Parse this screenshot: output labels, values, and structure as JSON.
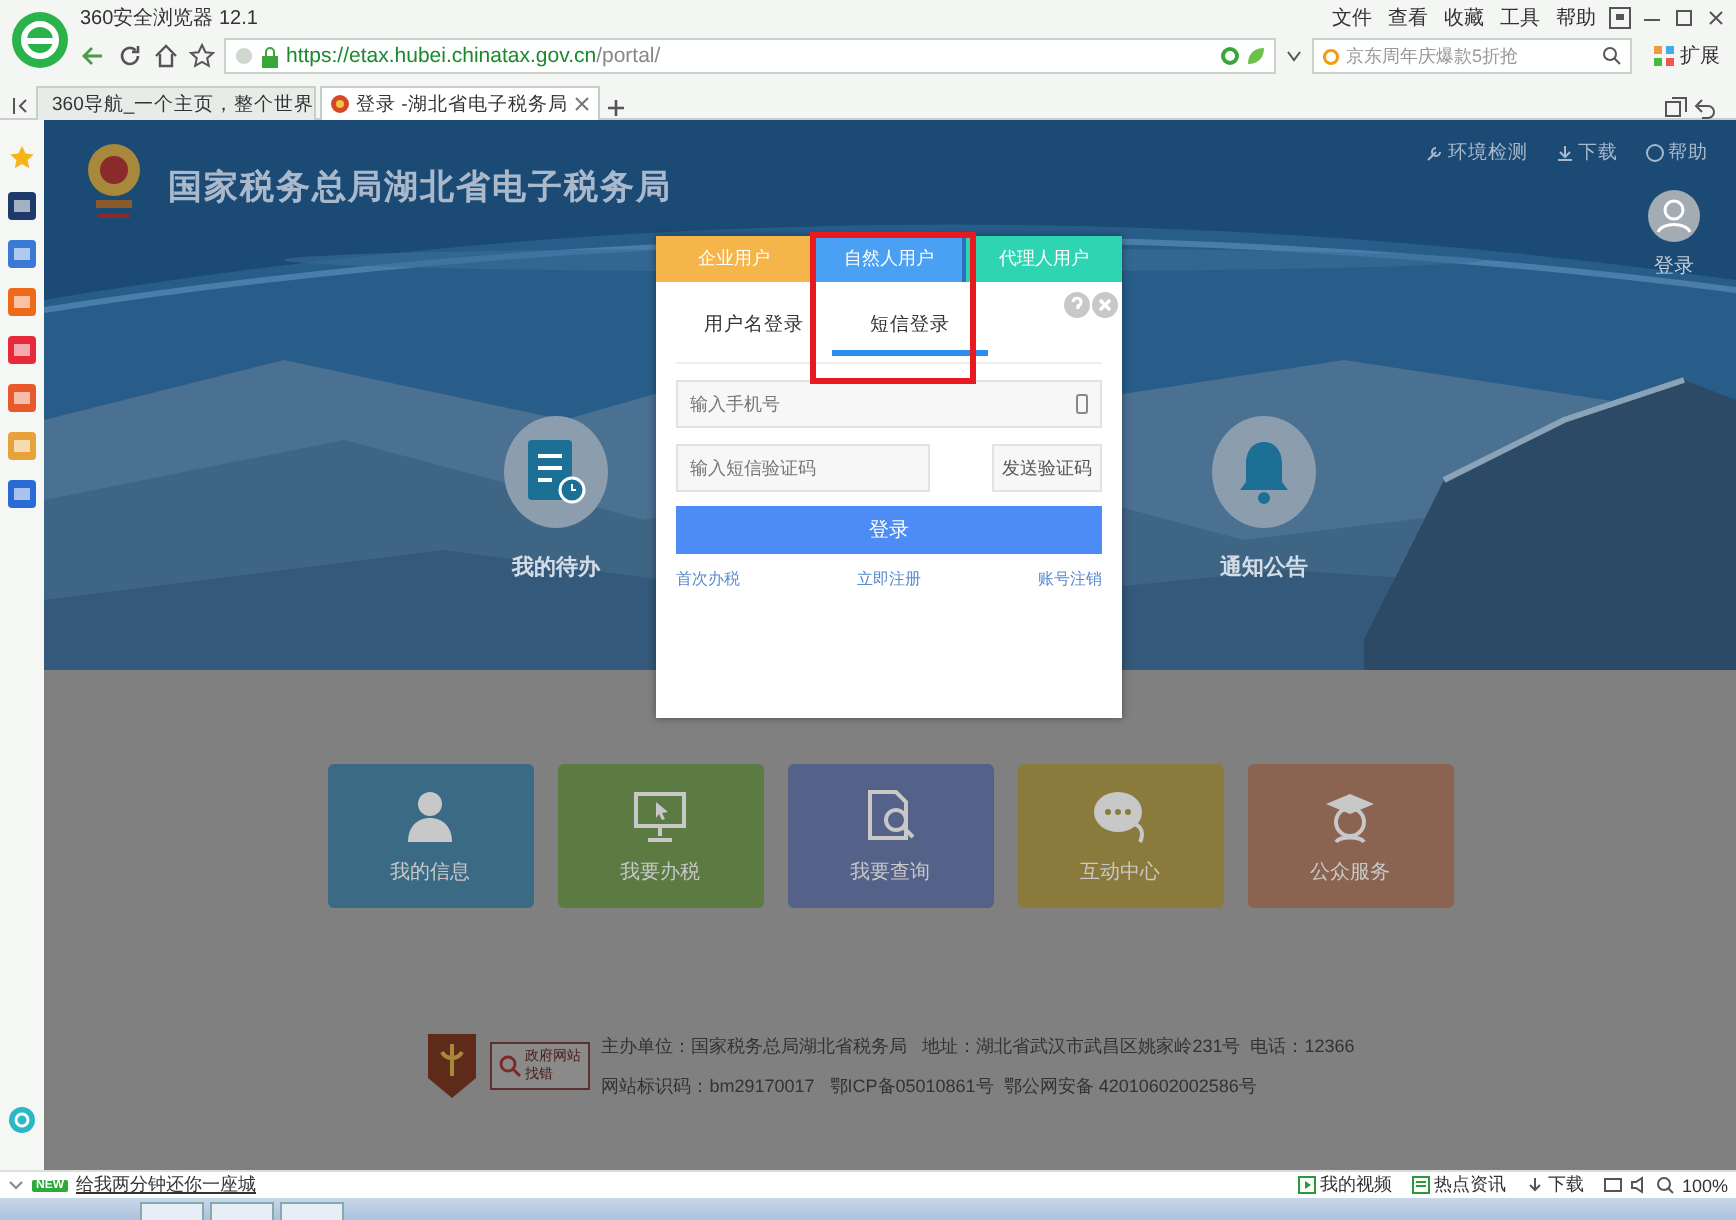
{
  "browser": {
    "title": "360安全浏览器 12.1",
    "menu": [
      "文件",
      "查看",
      "收藏",
      "工具",
      "帮助"
    ],
    "url_host": "https://etax.hubei.chinatax.gov.cn",
    "url_path": "/portal/",
    "search_placeholder": "京东周年庆爆款5折抢",
    "extensions": "扩展",
    "tabs": [
      {
        "label": "360导航_一个主页，整个世界",
        "selected": false
      },
      {
        "label": "登录 -湖北省电子税务局",
        "selected": true
      }
    ]
  },
  "site": {
    "title": "国家税务总局湖北省电子税务局",
    "top_links": [
      "环境检测",
      "下载",
      "帮助"
    ],
    "user_label": "登录",
    "features": [
      {
        "label": "我的待办",
        "kind": "todo"
      },
      {
        "label": "通知公告",
        "kind": "notice"
      }
    ],
    "tiles": [
      {
        "label": "我的信息",
        "kind": "person",
        "color": "#3b6a85"
      },
      {
        "label": "我要办税",
        "kind": "monitor",
        "color": "#5b7b43"
      },
      {
        "label": "我要查询",
        "kind": "search",
        "color": "#54628a"
      },
      {
        "label": "互动中心",
        "kind": "chat",
        "color": "#8a7b3d"
      },
      {
        "label": "公众服务",
        "kind": "service",
        "color": "#8a6351"
      }
    ],
    "footer_badge": [
      "政府网站",
      "找错"
    ],
    "footer_lines": [
      "主办单位：国家税务总局湖北省税务局   地址：湖北省武汉市武昌区姚家岭231号  电话：12366",
      "网站标识码：bm29170017   鄂ICP备05010861号  鄂公网安备 42010602002586号"
    ]
  },
  "modal": {
    "highlighted": true,
    "user_tabs": [
      {
        "label": "企业用户",
        "color": "#f6b54b",
        "selected": false
      },
      {
        "label": "自然人用户",
        "color": "#4aa0f2",
        "selected": true
      },
      {
        "label": "代理人用户",
        "color": "#2fd4b2",
        "selected": false
      }
    ],
    "login_tabs": [
      {
        "label": "用户名登录",
        "selected": false
      },
      {
        "label": "短信登录",
        "selected": true
      }
    ],
    "phone_placeholder": "输入手机号",
    "code_placeholder": "输入短信验证码",
    "send_code": "发送验证码",
    "login": "登录",
    "links": [
      "首次办税",
      "立即注册",
      "账号注销"
    ]
  },
  "status_bar": {
    "badge": "NEW",
    "news": "给我两分钟还你一座城",
    "items": [
      "我的视频",
      "热点资讯",
      "下载"
    ],
    "zoom": "100%"
  }
}
